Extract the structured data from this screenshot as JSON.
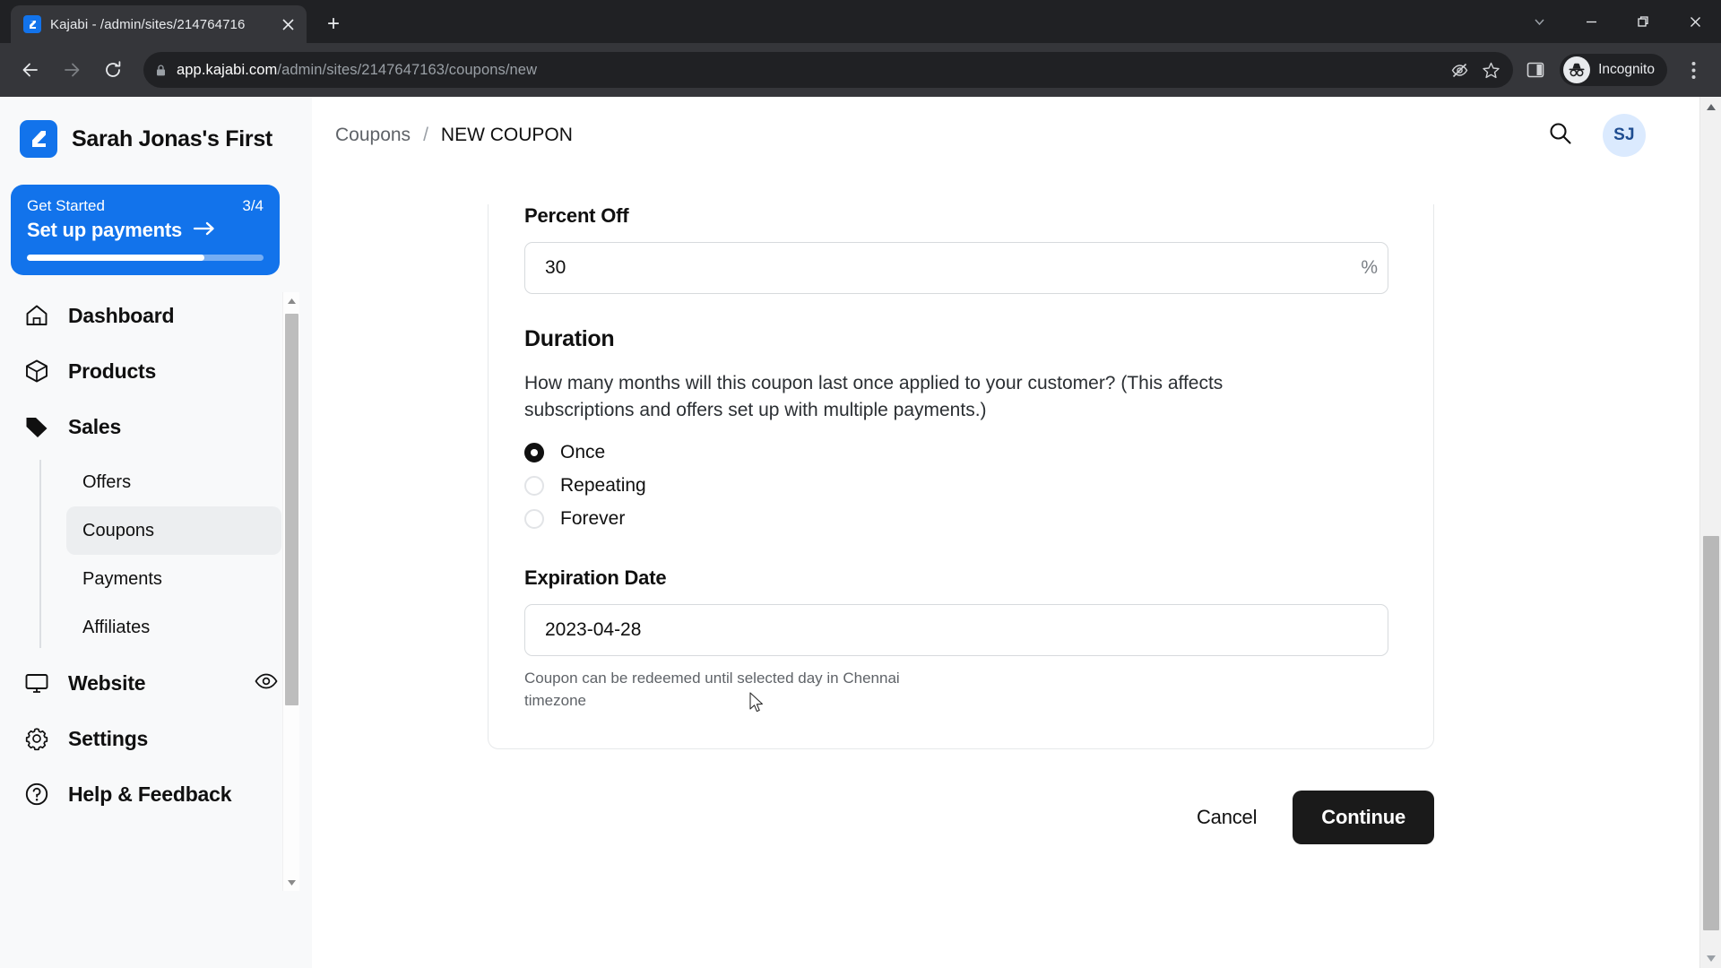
{
  "browser": {
    "tab": {
      "title": "Kajabi - /admin/sites/214764716",
      "favicon_icon": "kajabi-logo-icon",
      "close_icon": "close-icon"
    },
    "newtab_label": "+",
    "window_controls": {
      "minimize_group_icon": "chevron-down-icon",
      "minimize_icon": "minimize-icon",
      "maximize_icon": "maximize-icon",
      "close_icon": "close-icon"
    },
    "nav": {
      "back_icon": "back-arrow-icon",
      "forward_icon": "forward-arrow-icon",
      "reload_icon": "reload-icon"
    },
    "omnibox": {
      "lock_icon": "lock-icon",
      "url_host": "app.kajabi.com",
      "url_path": "/admin/sites/2147647163/coupons/new",
      "third_party_cookie_icon": "eye-slash-icon",
      "bookmark_icon": "star-icon"
    },
    "side_panel_icon": "side-panel-icon",
    "incognito": {
      "icon": "incognito-icon",
      "label": "Incognito"
    },
    "menu_icon": "kebab-menu-icon"
  },
  "sidebar": {
    "brand": {
      "logo_icon": "kajabi-logo-icon",
      "name": "Sarah Jonas's First"
    },
    "get_started": {
      "label": "Get Started",
      "count": "3/4",
      "action": "Set up payments",
      "arrow_icon": "arrow-right-icon",
      "progress_percent": 75,
      "accent_color": "#1273eb"
    },
    "items": [
      {
        "label": "Dashboard",
        "icon": "home-icon"
      },
      {
        "label": "Products",
        "icon": "box-icon"
      },
      {
        "label": "Sales",
        "icon": "tag-icon"
      }
    ],
    "sub_items": [
      {
        "label": "Offers",
        "active": false
      },
      {
        "label": "Coupons",
        "active": true
      },
      {
        "label": "Payments",
        "active": false
      },
      {
        "label": "Affiliates",
        "active": false
      }
    ],
    "items_bottom": [
      {
        "label": "Website",
        "icon": "monitor-icon",
        "trailing_icon": "eye-icon"
      },
      {
        "label": "Settings",
        "icon": "gear-icon",
        "trailing_icon": ""
      },
      {
        "label": "Help & Feedback",
        "icon": "question-circle-icon",
        "trailing_icon": ""
      }
    ],
    "scrollbar": {
      "up_icon": "scroll-up-arrow-icon",
      "down_icon": "scroll-down-arrow-icon"
    }
  },
  "header": {
    "breadcrumb": {
      "parent": "Coupons",
      "separator": "/",
      "current": "NEW COUPON"
    },
    "search_icon": "search-icon",
    "avatar_initials": "SJ"
  },
  "form": {
    "percent_off": {
      "label": "Percent Off",
      "value": "30",
      "suffix": "%"
    },
    "duration": {
      "title": "Duration",
      "help": "How many months will this coupon last once applied to your customer? (This affects subscriptions and offers set up with multiple payments.)",
      "options": [
        {
          "label": "Once",
          "checked": true
        },
        {
          "label": "Repeating",
          "checked": false
        },
        {
          "label": "Forever",
          "checked": false
        }
      ]
    },
    "expiration": {
      "label": "Expiration Date",
      "value": "2023-04-28",
      "hint": "Coupon can be redeemed until selected day in Chennai timezone"
    }
  },
  "footer": {
    "cancel_label": "Cancel",
    "continue_label": "Continue"
  },
  "page_scrollbar": {
    "up_icon": "scroll-up-arrow-icon",
    "down_icon": "scroll-down-arrow-icon"
  }
}
